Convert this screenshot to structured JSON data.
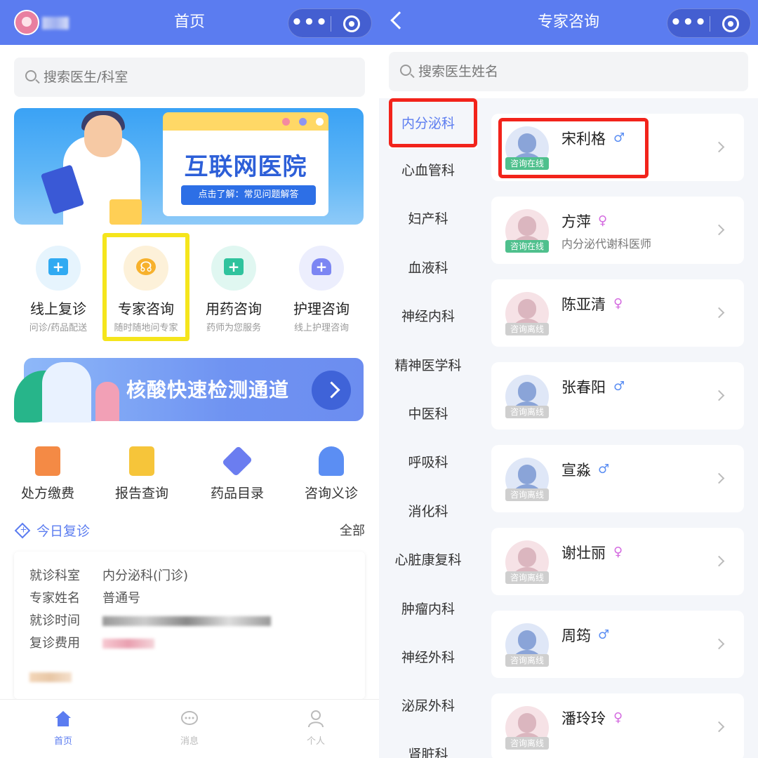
{
  "left": {
    "header_title": "首页",
    "search_placeholder": "搜索医生/科室",
    "banner": {
      "title": "互联网医院",
      "subtitle": "点击了解：常见问题解答"
    },
    "quick_actions": [
      {
        "label": "线上复诊",
        "sub": "问诊/药品配送",
        "color": "#30aaf2",
        "circle": "#e6f4fd"
      },
      {
        "label": "专家咨询",
        "sub": "随时随地问专家",
        "color": "#f7b12c",
        "circle": "#fdf1d9"
      },
      {
        "label": "用药咨询",
        "sub": "药师为您服务",
        "color": "#2fc39d",
        "circle": "#e0f7f1"
      },
      {
        "label": "护理咨询",
        "sub": "线上护理咨询",
        "color": "#7c86f3",
        "circle": "#eceefd"
      }
    ],
    "nat_banner": "核酸快速检测通道",
    "services": [
      {
        "label": "处方缴费",
        "color": "#f48a45"
      },
      {
        "label": "报告查询",
        "color": "#f6c53a"
      },
      {
        "label": "药品目录",
        "color": "#6b7df0"
      },
      {
        "label": "咨询义诊",
        "color": "#5b8ef3"
      }
    ],
    "today": {
      "title": "今日复诊",
      "all": "全部"
    },
    "card": {
      "rows": [
        {
          "key": "就诊科室",
          "value": "内分泌科(门诊)"
        },
        {
          "key": "专家姓名",
          "value": "普通号"
        },
        {
          "key": "就诊时间",
          "value": ""
        },
        {
          "key": "复诊费用",
          "value": ""
        }
      ]
    },
    "tabs": [
      {
        "label": "首页",
        "icon": "home-icon",
        "active": true
      },
      {
        "label": "消息",
        "icon": "message-icon",
        "active": false
      },
      {
        "label": "个人",
        "icon": "user-icon",
        "active": false
      }
    ]
  },
  "right": {
    "header_title": "专家咨询",
    "search_placeholder": "搜索医生姓名",
    "departments": [
      "内分泌科",
      "心血管科",
      "妇产科",
      "血液科",
      "神经内科",
      "精神医学科",
      "中医科",
      "呼吸科",
      "消化科",
      "心脏康复科",
      "肿瘤内科",
      "神经外科",
      "泌尿外科",
      "肾脏科"
    ],
    "selected_department": "内分泌科",
    "doctors": [
      {
        "name": "宋利格",
        "sex": "♂",
        "status": "咨询在线",
        "online": true,
        "desc": ""
      },
      {
        "name": "方萍",
        "sex": "♀",
        "status": "咨询在线",
        "online": true,
        "desc": "内分泌代谢科医师"
      },
      {
        "name": "陈亚清",
        "sex": "♀",
        "status": "咨询离线",
        "online": false,
        "desc": ""
      },
      {
        "name": "张春阳",
        "sex": "♂",
        "status": "咨询离线",
        "online": false,
        "desc": ""
      },
      {
        "name": "宣淼",
        "sex": "♂",
        "status": "咨询离线",
        "online": false,
        "desc": ""
      },
      {
        "name": "谢壮丽",
        "sex": "♀",
        "status": "咨询离线",
        "online": false,
        "desc": ""
      },
      {
        "name": "周筠",
        "sex": "♂",
        "status": "咨询离线",
        "online": false,
        "desc": ""
      },
      {
        "name": "潘玲玲",
        "sex": "♀",
        "status": "咨询离线",
        "online": false,
        "desc": ""
      }
    ]
  }
}
